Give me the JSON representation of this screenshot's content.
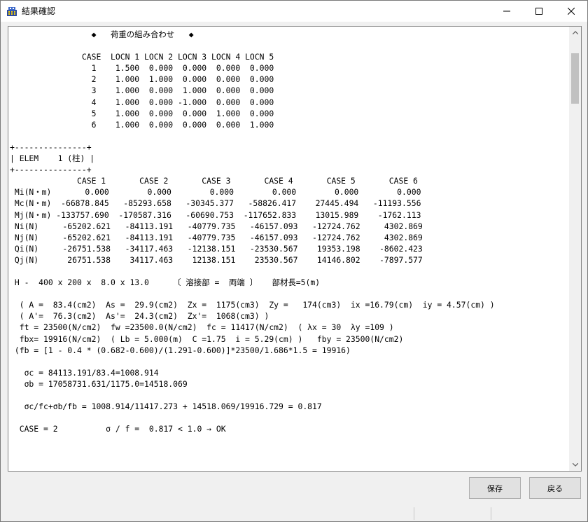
{
  "window": {
    "title": "結果確認",
    "app_icon": "building-icon",
    "controls": [
      "minimize-icon",
      "maximize-icon",
      "close-icon"
    ]
  },
  "report": {
    "lines": [
      "                 ◆   荷重の組み合わせ   ◆",
      "",
      "               CASE  LOCN 1 LOCN 2 LOCN 3 LOCN 4 LOCN 5",
      "                 1    1.500  0.000  0.000  0.000  0.000",
      "                 2    1.000  1.000  0.000  0.000  0.000",
      "                 3    1.000  0.000  1.000  0.000  0.000",
      "                 4    1.000  0.000 -1.000  0.000  0.000",
      "                 5    1.000  0.000  0.000  1.000  0.000",
      "                 6    1.000  0.000  0.000  0.000  1.000",
      "",
      "+---------------+",
      "| ELEM    1 (柱) |",
      "+---------------+",
      "              CASE 1       CASE 2       CASE 3       CASE 4       CASE 5       CASE 6",
      " Mi(N・m)       0.000        0.000        0.000        0.000        0.000        0.000",
      " Mc(N・m)  -66878.845   -85293.658   -30345.377   -58826.417    27445.494   -11193.556",
      " Mj(N・m) -133757.690  -170587.316   -60690.753  -117652.833    13015.989    -1762.113",
      " Ni(N)     -65202.621   -84113.191   -40779.735   -46157.093   -12724.762     4302.869",
      " Nj(N)     -65202.621   -84113.191   -40779.735   -46157.093   -12724.762     4302.869",
      " Qi(N)     -26751.538   -34117.463   -12138.151   -23530.567    19353.198    -8602.423",
      " Qj(N)      26751.538    34117.463    12138.151    23530.567    14146.802    -7897.577",
      "",
      " H -  400 x 200 x  8.0 x 13.0     〔 溶接部 =  両端 〕   部材長=5(m)",
      "",
      "  ( A =  83.4(cm2)  As =  29.9(cm2)  Zx =  1175(cm3)  Zy =   174(cm3)  ix =16.79(cm)  iy = 4.57(cm) )",
      "  ( A'=  76.3(cm2)  As'=  24.3(cm2)  Zx'=  1068(cm3) )",
      "  ft = 23500(N/cm2)  fw =23500.0(N/cm2)  fc = 11417(N/cm2)  ( λx = 30  λy =109 )",
      "  fbx= 19916(N/cm2)  ( Lb = 5.000(m)  C =1.75  i = 5.29(cm) )   fby = 23500(N/cm2)",
      " (fb = [1 - 0.4 * (0.682-0.600)/(1.291-0.600)]*23500/1.686*1.5 = 19916)",
      "",
      "   σc = 84113.191/83.4=1008.914",
      "   σb = 17058731.631/1175.0=14518.069",
      "",
      "   σc/fc+σb/fb = 1008.914/11417.273 + 14518.069/19916.729 = 0.817",
      "",
      "  CASE = 2          σ / f =  0.817 < 1.0 → OK"
    ]
  },
  "buttons": {
    "save_label": "保存",
    "back_label": "戻る"
  }
}
